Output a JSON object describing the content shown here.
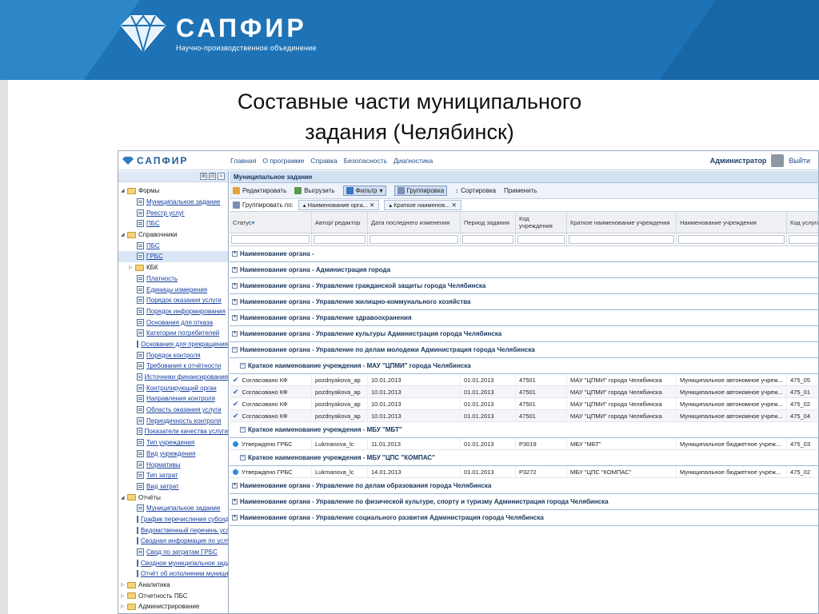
{
  "slide": {
    "brand": "САПФИР",
    "brand_sub": "Научно-производственное объединение",
    "title_line1": "Составные части муниципального",
    "title_line2": "задания (Челябинск)"
  },
  "app": {
    "brand": "САПФИР",
    "menu": [
      "Главная",
      "О программе",
      "Справка",
      "Безопасность",
      "Диагностика"
    ],
    "user": "Администратор",
    "logout": "Выйти"
  },
  "tree": [
    {
      "label": "Формы",
      "level": 1,
      "type": "folder",
      "arrow": "◢"
    },
    {
      "label": "Муниципальное задание",
      "level": 2,
      "type": "doc"
    },
    {
      "label": "Реестр услуг",
      "level": 2,
      "type": "doc"
    },
    {
      "label": "ПБС",
      "level": 2,
      "type": "doc"
    },
    {
      "label": "Справочники",
      "level": 1,
      "type": "folder",
      "arrow": "◢"
    },
    {
      "label": "ПБС",
      "level": 2,
      "type": "doc"
    },
    {
      "label": "ГРБС",
      "level": 2,
      "type": "doc",
      "selected": true
    },
    {
      "label": "КБК",
      "level": "2f",
      "type": "folder",
      "arrow": "▷"
    },
    {
      "label": "Платность",
      "level": 2,
      "type": "doc"
    },
    {
      "label": "Единицы измерения",
      "level": 2,
      "type": "doc"
    },
    {
      "label": "Порядок оказания услуги",
      "level": 2,
      "type": "doc"
    },
    {
      "label": "Порядок информирования",
      "level": 2,
      "type": "doc"
    },
    {
      "label": "Основания для отказа",
      "level": 2,
      "type": "doc"
    },
    {
      "label": "Категории потребителей",
      "level": 2,
      "type": "doc"
    },
    {
      "label": "Основания для прекращения",
      "level": 2,
      "type": "doc"
    },
    {
      "label": "Порядок контроля",
      "level": 2,
      "type": "doc"
    },
    {
      "label": "Требования к отчётности",
      "level": 2,
      "type": "doc"
    },
    {
      "label": "Источники финансирования",
      "level": 2,
      "type": "doc"
    },
    {
      "label": "Контролирующий орган",
      "level": 2,
      "type": "doc"
    },
    {
      "label": "Направления контроля",
      "level": 2,
      "type": "doc"
    },
    {
      "label": "Область оказания услуги",
      "level": 2,
      "type": "doc"
    },
    {
      "label": "Периодичность контроля",
      "level": 2,
      "type": "doc"
    },
    {
      "label": "Показатели качества услуги",
      "level": 2,
      "type": "doc"
    },
    {
      "label": "Тип учреждения",
      "level": 2,
      "type": "doc"
    },
    {
      "label": "Вид учреждения",
      "level": 2,
      "type": "doc"
    },
    {
      "label": "Нормативы",
      "level": 2,
      "type": "doc"
    },
    {
      "label": "Тип затрат",
      "level": 2,
      "type": "doc"
    },
    {
      "label": "Вид затрат",
      "level": 2,
      "type": "doc"
    },
    {
      "label": "Отчёты",
      "level": 1,
      "type": "folder",
      "arrow": "◢"
    },
    {
      "label": "Муниципальное задание",
      "level": 2,
      "type": "doc"
    },
    {
      "label": "График перечисления субсидий",
      "level": 2,
      "type": "doc"
    },
    {
      "label": "Ведомственный перечень услуг",
      "level": 2,
      "type": "doc"
    },
    {
      "label": "Сводная информация по услугам",
      "level": 2,
      "type": "doc"
    },
    {
      "label": "Свод по затратам ГРБС",
      "level": 2,
      "type": "doc"
    },
    {
      "label": "Сводное муниципальное задание",
      "level": 2,
      "type": "doc"
    },
    {
      "label": "Отчёт об исполнении муниципального",
      "level": 2,
      "type": "doc"
    },
    {
      "label": "Аналитика",
      "level": 1,
      "type": "folder",
      "arrow": "▷"
    },
    {
      "label": "Отчетность ПБС",
      "level": 1,
      "type": "folder",
      "arrow": "▷"
    },
    {
      "label": "Администрирование",
      "level": 1,
      "type": "folder",
      "arrow": "▷"
    }
  ],
  "panel": {
    "title": "Муниципальное задание",
    "toolbar": [
      "Редактировать",
      "Выгрузить",
      "Фильтр",
      "Группировка",
      "Сортировка",
      "Применить"
    ],
    "group_by_label": "Группировать по:",
    "group_chips": [
      "Наименование орга...",
      "Краткое наименов..."
    ]
  },
  "columns": [
    "Статус",
    "Автор/ редактор",
    "Дата последнего изменения",
    "Период задания",
    "Код учреждения",
    "Краткое наименование учреждения",
    "Наименование учреждения",
    "Код услуги"
  ],
  "groups": [
    {
      "kind": "g",
      "label": "Наименование органа -"
    },
    {
      "kind": "g",
      "label": "Наименование органа - Администрация города"
    },
    {
      "kind": "g",
      "label": "Наименование органа - Управление гражданской защиты города Челябинска"
    },
    {
      "kind": "g",
      "label": "Наименование органа - Управление жилищно-коммунального хозяйства"
    },
    {
      "kind": "g",
      "label": "Наименование органа - Управление здравоохранения"
    },
    {
      "kind": "g",
      "label": "Наименование органа - Управление культуры Администрация города Челябинска"
    },
    {
      "kind": "g",
      "label": "Наименование органа - Управление по делам молодежи Администрация города Челябинска",
      "open": true
    },
    {
      "kind": "s",
      "label": "Краткое наименование учреждения - МАУ \"ЦПМИ\" города Челябинска"
    },
    {
      "kind": "r",
      "icon": "check",
      "cells": [
        "Согласовано КФ",
        "pozdnyakova_ap",
        "10.01.2013",
        "01.01.2013",
        "47501",
        "МАУ \"ЦПМИ\" города Челябинска",
        "Муниципальное автономное учреж...",
        "475_05"
      ]
    },
    {
      "kind": "r",
      "icon": "check",
      "cells": [
        "Согласовано КФ",
        "pozdnyakova_ap",
        "10.01.2013",
        "01.01.2013",
        "47501",
        "МАУ \"ЦПМИ\" города Челябинска",
        "Муниципальное автономное учреж...",
        "475_01"
      ]
    },
    {
      "kind": "r",
      "icon": "check",
      "cells": [
        "Согласовано КФ",
        "pozdnyakova_ap",
        "10.01.2013",
        "01.01.2013",
        "47501",
        "МАУ \"ЦПМИ\" города Челябинска",
        "Муниципальное автономное учреж...",
        "475_02"
      ]
    },
    {
      "kind": "r",
      "icon": "check",
      "cells": [
        "Согласовано КФ",
        "pozdnyakova_ap",
        "10.01.2013",
        "01.01.2013",
        "47501",
        "МАУ \"ЦПМИ\" города Челябинска",
        "Муниципальное автономное учреж...",
        "475_04"
      ]
    },
    {
      "kind": "s",
      "label": "Краткое наименование учреждения - МБУ \"МБТ\""
    },
    {
      "kind": "r",
      "icon": "dot",
      "cells": [
        "Утверждено ГРБС",
        "Lukmanova_lc",
        "11.01.2013",
        "01.01.2013",
        "Р3019",
        "МБУ \"МБТ\"",
        "Муниципальное бюджетное учреж...",
        "475_03"
      ]
    },
    {
      "kind": "s",
      "label": "Краткое наименование учреждения - МБУ \"ЦПС \"КОМПАС\""
    },
    {
      "kind": "r",
      "icon": "dot",
      "cells": [
        "Утверждено ГРБС",
        "Lukmanova_lc",
        "14.01.2013",
        "01.01.2013",
        "Р3272",
        "МБУ \"ЦПС \"КОМПАС\"",
        "Муниципальное бюджетное учреж...",
        "475_02"
      ]
    },
    {
      "kind": "g",
      "label": "Наименование органа - Управление по делам образования города Челябинска"
    },
    {
      "kind": "g",
      "label": "Наименование органа - Управление по физической культуре, спорту и туризму Администрация города Челябинска"
    },
    {
      "kind": "g",
      "label": "Наименование органа - Управление социального развития Администрация города Челябинска"
    }
  ]
}
